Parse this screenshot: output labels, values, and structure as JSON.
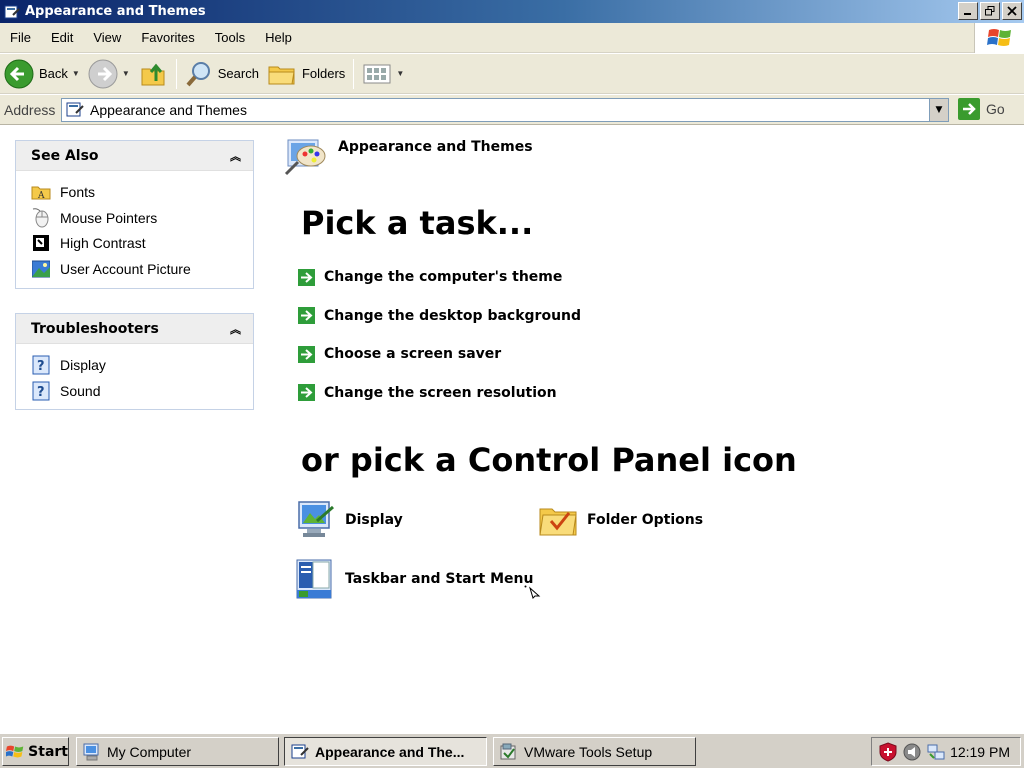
{
  "window": {
    "title": "Appearance and Themes"
  },
  "menu": {
    "items": [
      "File",
      "Edit",
      "View",
      "Favorites",
      "Tools",
      "Help"
    ]
  },
  "toolbar": {
    "back_label": "Back",
    "search_label": "Search",
    "folders_label": "Folders"
  },
  "address": {
    "label": "Address",
    "value": "Appearance and Themes",
    "go_label": "Go"
  },
  "sidebar": {
    "see_also": {
      "title": "See Also",
      "items": [
        {
          "label": "Fonts",
          "icon": "fonts-folder-icon"
        },
        {
          "label": "Mouse Pointers",
          "icon": "mouse-icon"
        },
        {
          "label": "High Contrast",
          "icon": "high-contrast-icon"
        },
        {
          "label": "User Account Picture",
          "icon": "user-picture-icon"
        }
      ]
    },
    "troubleshooters": {
      "title": "Troubleshooters",
      "items": [
        {
          "label": "Display",
          "icon": "help-icon"
        },
        {
          "label": "Sound",
          "icon": "help-icon"
        }
      ]
    }
  },
  "main": {
    "category_title": "Appearance and Themes",
    "pick_task_heading": "Pick a task...",
    "tasks": [
      "Change the computer's theme",
      "Change the desktop background",
      "Choose a screen saver",
      "Change the screen resolution"
    ],
    "pick_icon_heading": "or pick a Control Panel icon",
    "icons": [
      {
        "label": "Display",
        "icon": "display-icon"
      },
      {
        "label": "Folder Options",
        "icon": "folder-options-icon"
      },
      {
        "label": "Taskbar and Start Menu",
        "icon": "taskbar-icon"
      }
    ]
  },
  "taskbar": {
    "start_label": "Start",
    "buttons": [
      {
        "label": "My Computer",
        "active": false
      },
      {
        "label": "Appearance and The...",
        "active": true
      },
      {
        "label": "VMware Tools Setup",
        "active": false
      }
    ],
    "clock": "12:19 PM"
  },
  "colors": {
    "title_bar_start": "#0a246a",
    "title_bar_end": "#a6caf0",
    "chrome": "#ece9d8",
    "task_arrow": "#2e9d3a"
  }
}
